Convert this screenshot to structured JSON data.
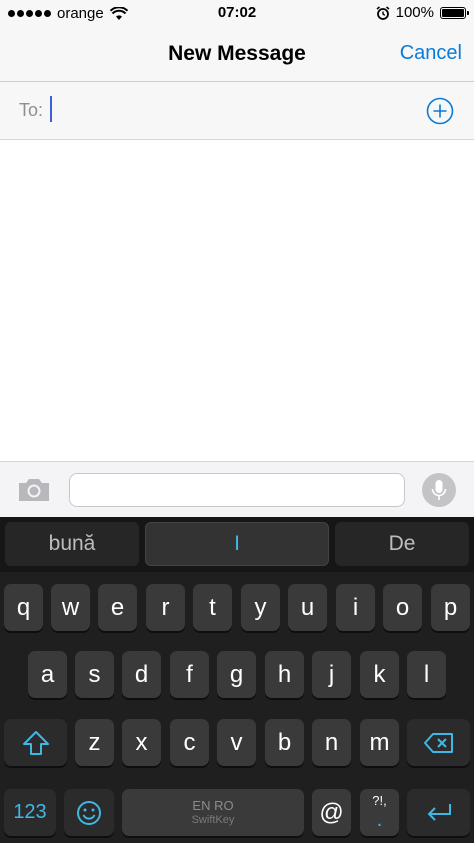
{
  "status_bar": {
    "carrier": "orange",
    "time": "07:02",
    "battery": "100%",
    "battery_level": 1.0
  },
  "nav": {
    "title": "New Message",
    "cancel_label": "Cancel"
  },
  "recipient": {
    "label": "To:",
    "value": ""
  },
  "compose": {
    "value": ""
  },
  "keyboard": {
    "predictions": [
      "bună",
      "I",
      "De"
    ],
    "row1": [
      "q",
      "w",
      "e",
      "r",
      "t",
      "y",
      "u",
      "i",
      "o",
      "p"
    ],
    "row2": [
      "a",
      "s",
      "d",
      "f",
      "g",
      "h",
      "j",
      "k",
      "l"
    ],
    "row3": [
      "z",
      "x",
      "c",
      "v",
      "b",
      "n",
      "m"
    ],
    "numbers_label": "123",
    "space_language": "EN RO",
    "space_brand": "SwiftKey",
    "at_label": "@",
    "punct_top": "?!,",
    "punct_bottom": "."
  },
  "colors": {
    "accent": "#0a7bd6",
    "keyboard_accent": "#3fb8e6",
    "caret": "#3a5fd9"
  },
  "icons": {
    "wifi": "wifi-icon",
    "alarm": "alarm-icon",
    "add_contact": "plus-circle-icon",
    "camera": "camera-icon",
    "mic": "microphone-icon",
    "shift": "shift-icon",
    "backspace": "backspace-icon",
    "emoji": "emoji-icon",
    "enter": "return-icon"
  }
}
